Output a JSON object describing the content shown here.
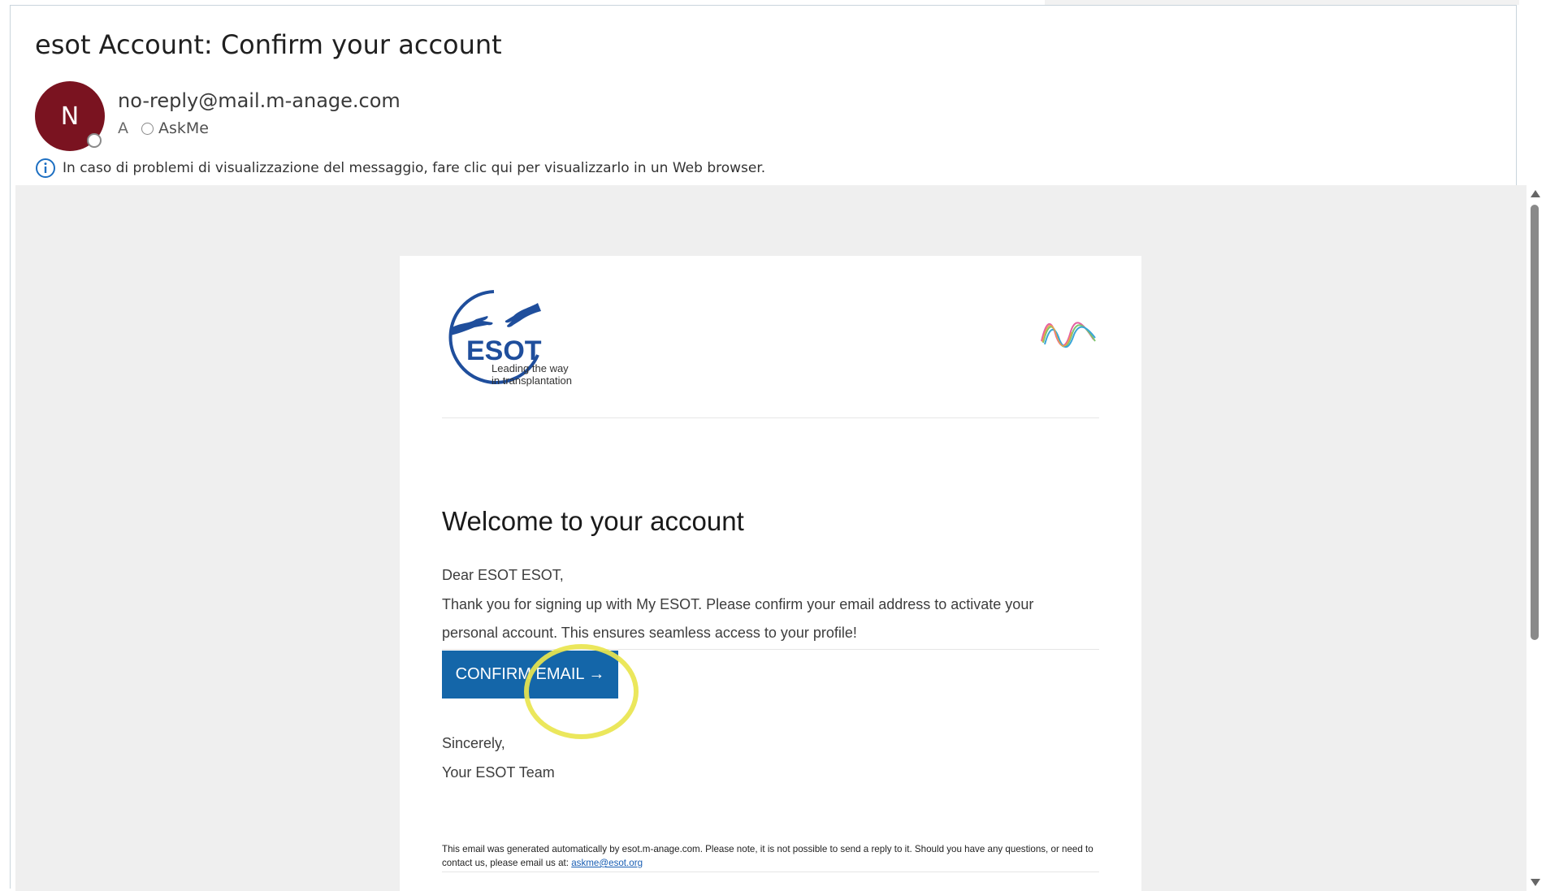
{
  "message": {
    "subject": "esot Account: Confirm your account",
    "avatar_initial": "N",
    "sender": "no-reply@mail.m-anage.com",
    "to_label": "A",
    "to_recipient": "AskMe",
    "info_notice": "In caso di problemi di visualizzazione del messaggio, fare clic qui per visualizzarlo in un Web browser."
  },
  "email": {
    "logo_text": "ESOT",
    "logo_tagline_1": "Leading the way",
    "logo_tagline_2": "in transplantation",
    "heading": "Welcome to your account",
    "greeting": "Dear ESOT ESOT,",
    "body_line_1": "Thank you for signing up with My ESOT. Please confirm your email address to activate your",
    "body_line_2": "personal account. This ensures seamless access to your profile!",
    "button_label": "CONFIRM EMAIL →",
    "closing": "Sincerely,",
    "signature": "Your ESOT Team",
    "footer_text": "This email was generated automatically by esot.m-anage.com. Please note, it is not possible to send a reply to it. Should you have any questions, or need to contact us, please email us at:",
    "footer_link": "askme@esot.org"
  },
  "colors": {
    "avatar_bg": "#7a1320",
    "button_bg": "#1466a9",
    "highlight": "#e9e54e",
    "logo_blue": "#1f4e9c"
  },
  "icons": {
    "info": "info-circle-icon",
    "scroll_up": "scroll-up-arrow-icon",
    "scroll_down": "scroll-down-arrow-icon"
  }
}
